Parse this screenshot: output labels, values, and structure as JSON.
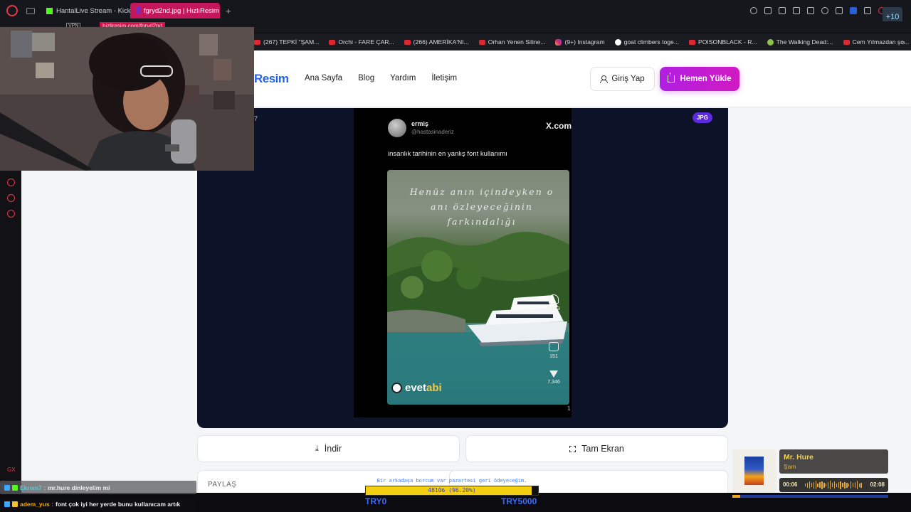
{
  "browser": {
    "tabs": [
      {
        "label": "HantalLive Stream - Kick D",
        "active": false
      },
      {
        "label": "fgryd2nd.jpg | HızlıResim",
        "active": true
      }
    ],
    "vpn_label": "VPN",
    "url_text": "hizliresim.com/fgryd2nd",
    "bookmarks": [
      {
        "label": "(267) TEPKİ \"ŞAM...",
        "icon": "youtube-icon"
      },
      {
        "label": "Orchi - FARE ÇAR...",
        "icon": "youtube-icon"
      },
      {
        "label": "(266) AMERİKA'NI...",
        "icon": "youtube-icon"
      },
      {
        "label": "Orhan Yenen Siline...",
        "icon": "youtube-icon"
      },
      {
        "label": "(9+) Instagram",
        "icon": "instagram-icon"
      },
      {
        "label": "goat climbers toge...",
        "icon": "google-icon"
      },
      {
        "label": "POISONBLACK - R...",
        "icon": "youtube-icon"
      },
      {
        "label": "The Walking Dead:...",
        "icon": "walkingdead-icon"
      },
      {
        "label": "Cem Yılmazdan şo...",
        "icon": "youtube-icon"
      }
    ],
    "sidebar_gx": "GX",
    "profile_chip": "+10"
  },
  "site": {
    "logo": "Resim",
    "nav": [
      "Ana Sayfa",
      "Blog",
      "Yardım",
      "İletişim"
    ],
    "login_label": "Giriş Yap",
    "upload_label": "Hemen Yükle",
    "badge": "JPG",
    "frame_number": "7",
    "download_label": "İndir",
    "fullscreen_label": "Tam Ekran",
    "share_title": "PAYLAŞ"
  },
  "post": {
    "name": "ermiş",
    "handle": "@hastasinaderiz",
    "site": "X.com",
    "text": "insanlık tarihinin en yanlış font kullanımı",
    "image_caption": "Henüz anın içindeyken o anı özleyeceğinin farkındalığı",
    "watermark_a": "evet",
    "watermark_b": "abi",
    "likes": "6.973",
    "reposts": "151",
    "shares": "7.346",
    "corner_num": "1"
  },
  "stream": {
    "chat": [
      {
        "user": "Ekrem7",
        "message": "mr.hure dinleyelim mi"
      },
      {
        "user": "adem_yus",
        "message": "font çok iyi her yerde bunu kullanıcam artık"
      }
    ],
    "donation_text": "Bir arkadaşa borcum var pazartesi geri ödeyeceğim.",
    "donation_value": "4810₺ (96.20%)",
    "donation_progress": 0.962,
    "donation_left": "TRY0",
    "donation_right": "TRY5000",
    "song_title": "Mr. Hure",
    "song_artist": "Şam",
    "song_elapsed": "00:06",
    "song_total": "02:08",
    "song_progress": 0.05
  },
  "colors": {
    "accent_purple": "#b01fe0",
    "logo_blue": "#2563eb",
    "opera_red": "#e23a48",
    "tab_active": "#c2185b"
  }
}
